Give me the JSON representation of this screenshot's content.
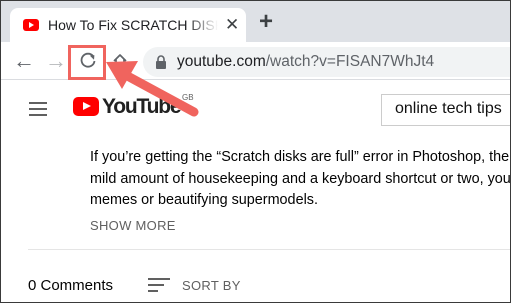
{
  "browser": {
    "tab": {
      "title": "How To Fix SCRATCH DISKS ARE FULL",
      "favicon": "youtube-favicon-icon",
      "close_glyph": "✕"
    },
    "new_tab_glyph": "+",
    "toolbar": {
      "back_glyph": "←",
      "forward_glyph": "→",
      "reload_icon": "reload-icon",
      "home_icon": "home-icon"
    },
    "omnibox": {
      "host": "youtube.com",
      "path": "/watch?v=FISAN7WhJt4"
    }
  },
  "youtube": {
    "logo_text": "YouTube",
    "country_code": "GB",
    "search_value": "online tech tips"
  },
  "description": {
    "lines": [
      "If you’re getting the “Scratch disks are full” error in Photoshop, there’",
      "mild amount of housekeeping and a keyboard shortcut or two, you c",
      "memes or beautifying supermodels."
    ],
    "show_more_label": "SHOW MORE"
  },
  "comments": {
    "count_label": "0 Comments",
    "sort_label": "SORT BY"
  },
  "colors": {
    "highlight": "#f0645e",
    "youtube_red": "#ff0000"
  }
}
